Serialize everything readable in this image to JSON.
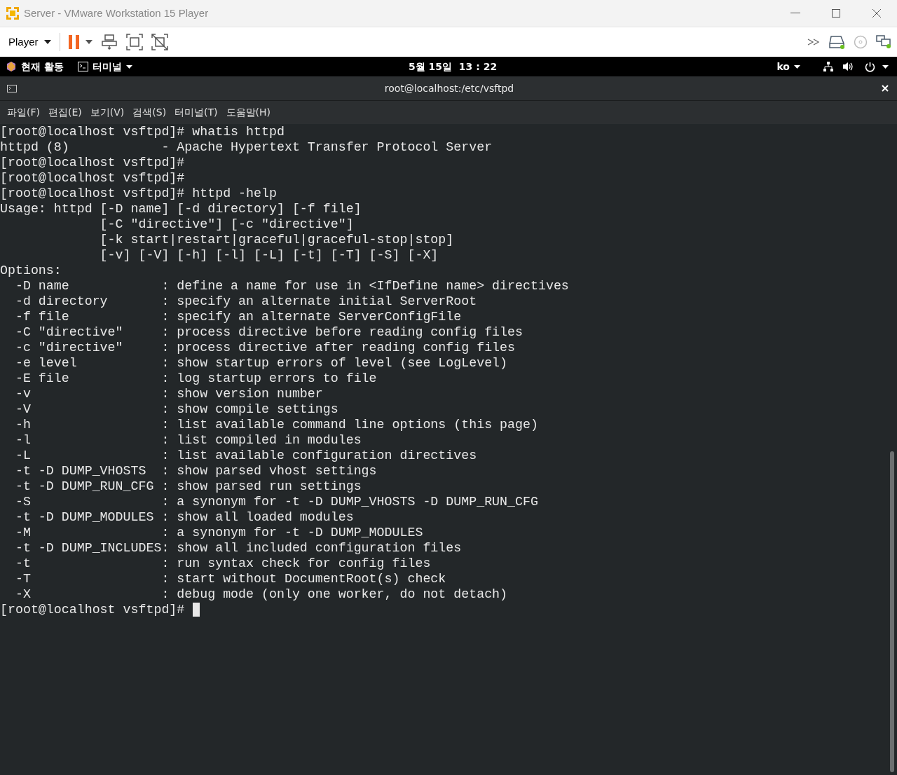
{
  "window": {
    "title": "Server - VMware Workstation 15 Player"
  },
  "toolbar": {
    "player_menu": "Player"
  },
  "top_bar": {
    "activities": "현재 활동",
    "app_menu": "터미널",
    "clock": "5월 15일  13 : 22",
    "input_method": "ko"
  },
  "terminal_window": {
    "title": "root@localhost:/etc/vsftpd"
  },
  "menu": [
    "파일(F)",
    "편집(E)",
    "보기(V)",
    "검색(S)",
    "터미널(T)",
    "도움말(H)"
  ],
  "terminal_lines": [
    "[root@localhost vsftpd]# whatis httpd",
    "httpd (8)            - Apache Hypertext Transfer Protocol Server",
    "[root@localhost vsftpd]#",
    "[root@localhost vsftpd]#",
    "[root@localhost vsftpd]# httpd -help",
    "Usage: httpd [-D name] [-d directory] [-f file]",
    "             [-C \"directive\"] [-c \"directive\"]",
    "             [-k start|restart|graceful|graceful-stop|stop]",
    "             [-v] [-V] [-h] [-l] [-L] [-t] [-T] [-S] [-X]",
    "Options:",
    "  -D name            : define a name for use in <IfDefine name> directives",
    "  -d directory       : specify an alternate initial ServerRoot",
    "  -f file            : specify an alternate ServerConfigFile",
    "  -C \"directive\"     : process directive before reading config files",
    "  -c \"directive\"     : process directive after reading config files",
    "  -e level           : show startup errors of level (see LogLevel)",
    "  -E file            : log startup errors to file",
    "  -v                 : show version number",
    "  -V                 : show compile settings",
    "  -h                 : list available command line options (this page)",
    "  -l                 : list compiled in modules",
    "  -L                 : list available configuration directives",
    "  -t -D DUMP_VHOSTS  : show parsed vhost settings",
    "  -t -D DUMP_RUN_CFG : show parsed run settings",
    "  -S                 : a synonym for -t -D DUMP_VHOSTS -D DUMP_RUN_CFG",
    "  -t -D DUMP_MODULES : show all loaded modules",
    "  -M                 : a synonym for -t -D DUMP_MODULES",
    "  -t -D DUMP_INCLUDES: show all included configuration files",
    "  -t                 : run syntax check for config files",
    "  -T                 : start without DocumentRoot(s) check",
    "  -X                 : debug mode (only one worker, do not detach)",
    "[root@localhost vsftpd]#"
  ]
}
